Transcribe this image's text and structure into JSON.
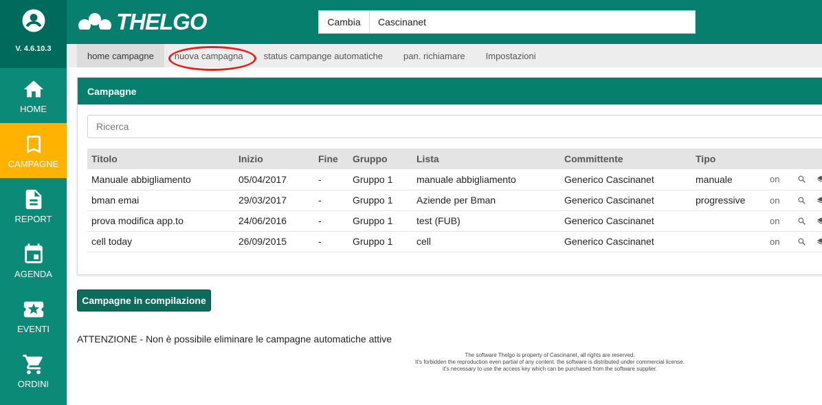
{
  "sidebar": {
    "version": "V. 4.6.10.3",
    "items": [
      {
        "label": "HOME",
        "icon": "home-icon"
      },
      {
        "label": "CAMPAGNE",
        "icon": "bookmark-icon"
      },
      {
        "label": "REPORT",
        "icon": "document-icon"
      },
      {
        "label": "AGENDA",
        "icon": "calendar-icon"
      },
      {
        "label": "EVENTI",
        "icon": "ticket-icon"
      },
      {
        "label": "ORDINI",
        "icon": "cart-icon"
      }
    ]
  },
  "header": {
    "logo_text": "THELGO",
    "cambia_label": "Cambia",
    "company_value": "Cascinanet"
  },
  "tabs": [
    {
      "label": "home campagne"
    },
    {
      "label": "nuova campagna"
    },
    {
      "label": "status campange automatiche"
    },
    {
      "label": "pan. richiamare"
    },
    {
      "label": "Impostazioni"
    }
  ],
  "panel": {
    "title": "Campagne",
    "search_placeholder": "Ricerca",
    "columns": [
      "Titolo",
      "Inizio",
      "Fine",
      "Gruppo",
      "Lista",
      "Committente",
      "Tipo"
    ],
    "rows": [
      {
        "titolo": "Manuale abbigliamento",
        "inizio": "05/04/2017",
        "fine": "-",
        "gruppo": "Gruppo 1",
        "lista": "manuale abbigliamento",
        "committente": "Generico Cascinanet",
        "tipo": "manuale",
        "status": "on"
      },
      {
        "titolo": "bman emai",
        "inizio": "29/03/2017",
        "fine": "-",
        "gruppo": "Gruppo 1",
        "lista": "Aziende per Bman",
        "committente": "Generico Cascinanet",
        "tipo": "progressive",
        "status": "on"
      },
      {
        "titolo": "prova modifica app.to",
        "inizio": "24/06/2016",
        "fine": "-",
        "gruppo": "Gruppo 1",
        "lista": "test (FUB)",
        "committente": "Generico Cascinanet",
        "tipo": "",
        "status": "on"
      },
      {
        "titolo": "cell today",
        "inizio": "26/09/2015",
        "fine": "-",
        "gruppo": "Gruppo 1",
        "lista": "cell",
        "committente": "Generico Cascinanet",
        "tipo": "",
        "status": "on"
      }
    ]
  },
  "compile_button": "Campagne in compilazione",
  "warning": "ATTENZIONE - Non è possibile eliminare le campagne automatiche attive",
  "legal": [
    "The software Thelgo is property of Cascinanet, all rights are reserved.",
    "It's forbidden the reproduction even partial of any content. the software is distributed under commercial license.",
    "it's necessary to use the access key which can be purchased from the software supplier."
  ],
  "colors": {
    "primary": "#077f6e",
    "sidebar": "#0b8a78",
    "active": "#ffb300",
    "highlight": "#e2231a"
  }
}
